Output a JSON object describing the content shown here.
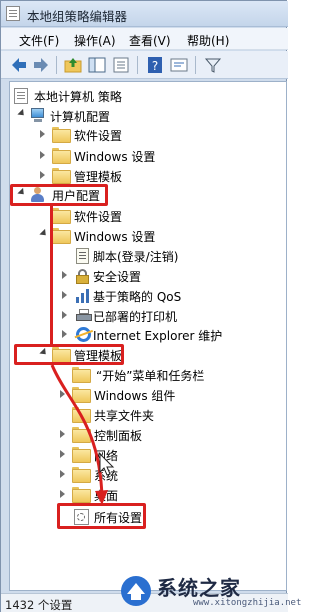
{
  "window": {
    "title": "本地组策略编辑器"
  },
  "menu": [
    "文件(F)",
    "操作(A)",
    "查看(V)",
    "帮助(H)"
  ],
  "toolbar_icons": [
    "back-arrow-icon",
    "forward-arrow-icon",
    "folder-up-icon",
    "show-hide-tree-icon",
    "export-list-icon",
    "help-icon",
    "properties-icon",
    "filter-icon"
  ],
  "tree": {
    "root": "本地计算机 策略",
    "computer_config": "计算机配置",
    "cc_software": "软件设置",
    "cc_windows": "Windows 设置",
    "cc_admin": "管理模板",
    "user_config": "用户配置",
    "uc_software": "软件设置",
    "uc_windows": "Windows 设置",
    "uc_scripts": "脚本(登录/注销)",
    "uc_security": "安全设置",
    "uc_qos": "基于策略的 QoS",
    "uc_printers": "已部署的打印机",
    "uc_ie": "Internet Explorer 维护",
    "uc_admin": "管理模板",
    "ad_startmenu": "“开始”菜单和任务栏",
    "ad_windows": "Windows 组件",
    "ad_shared": "共享文件夹",
    "ad_control": "控制面板",
    "ad_network": "网络",
    "ad_system": "系统",
    "ad_desktop": "桌面",
    "ad_all": "所有设置"
  },
  "status": {
    "text": "1432 个设置"
  },
  "watermark": {
    "brand": "系统之家",
    "url": "www.xitongzhijia.net"
  },
  "colors": {
    "annotation_red": "#d9201f"
  }
}
